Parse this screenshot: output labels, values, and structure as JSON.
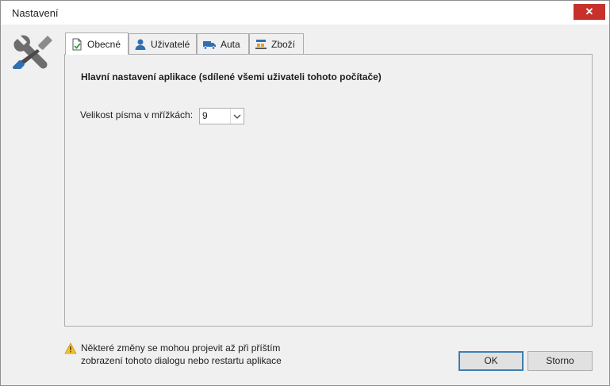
{
  "window": {
    "title": "Nastavení",
    "close_label": "✕"
  },
  "tabs": [
    {
      "label": "Obecné",
      "icon": "document-check-icon",
      "active": true
    },
    {
      "label": "Uživatelé",
      "icon": "user-icon",
      "active": false
    },
    {
      "label": "Auta",
      "icon": "truck-icon",
      "active": false
    },
    {
      "label": "Zboží",
      "icon": "goods-icon",
      "active": false
    }
  ],
  "general": {
    "heading": "Hlavní nastavení aplikace (sdílené všemi uživateli tohoto počítače)",
    "font_size_label": "Velikost písma v mřížkách:",
    "font_size_value": "9"
  },
  "footer": {
    "warning_line1": "Některé změny se mohou projevit až při příštím",
    "warning_line2": "zobrazení tohoto dialogu nebo restartu aplikace",
    "ok_label": "OK",
    "cancel_label": "Storno"
  },
  "colors": {
    "close_button": "#c7312b",
    "accent_blue": "#2f6fb3"
  }
}
